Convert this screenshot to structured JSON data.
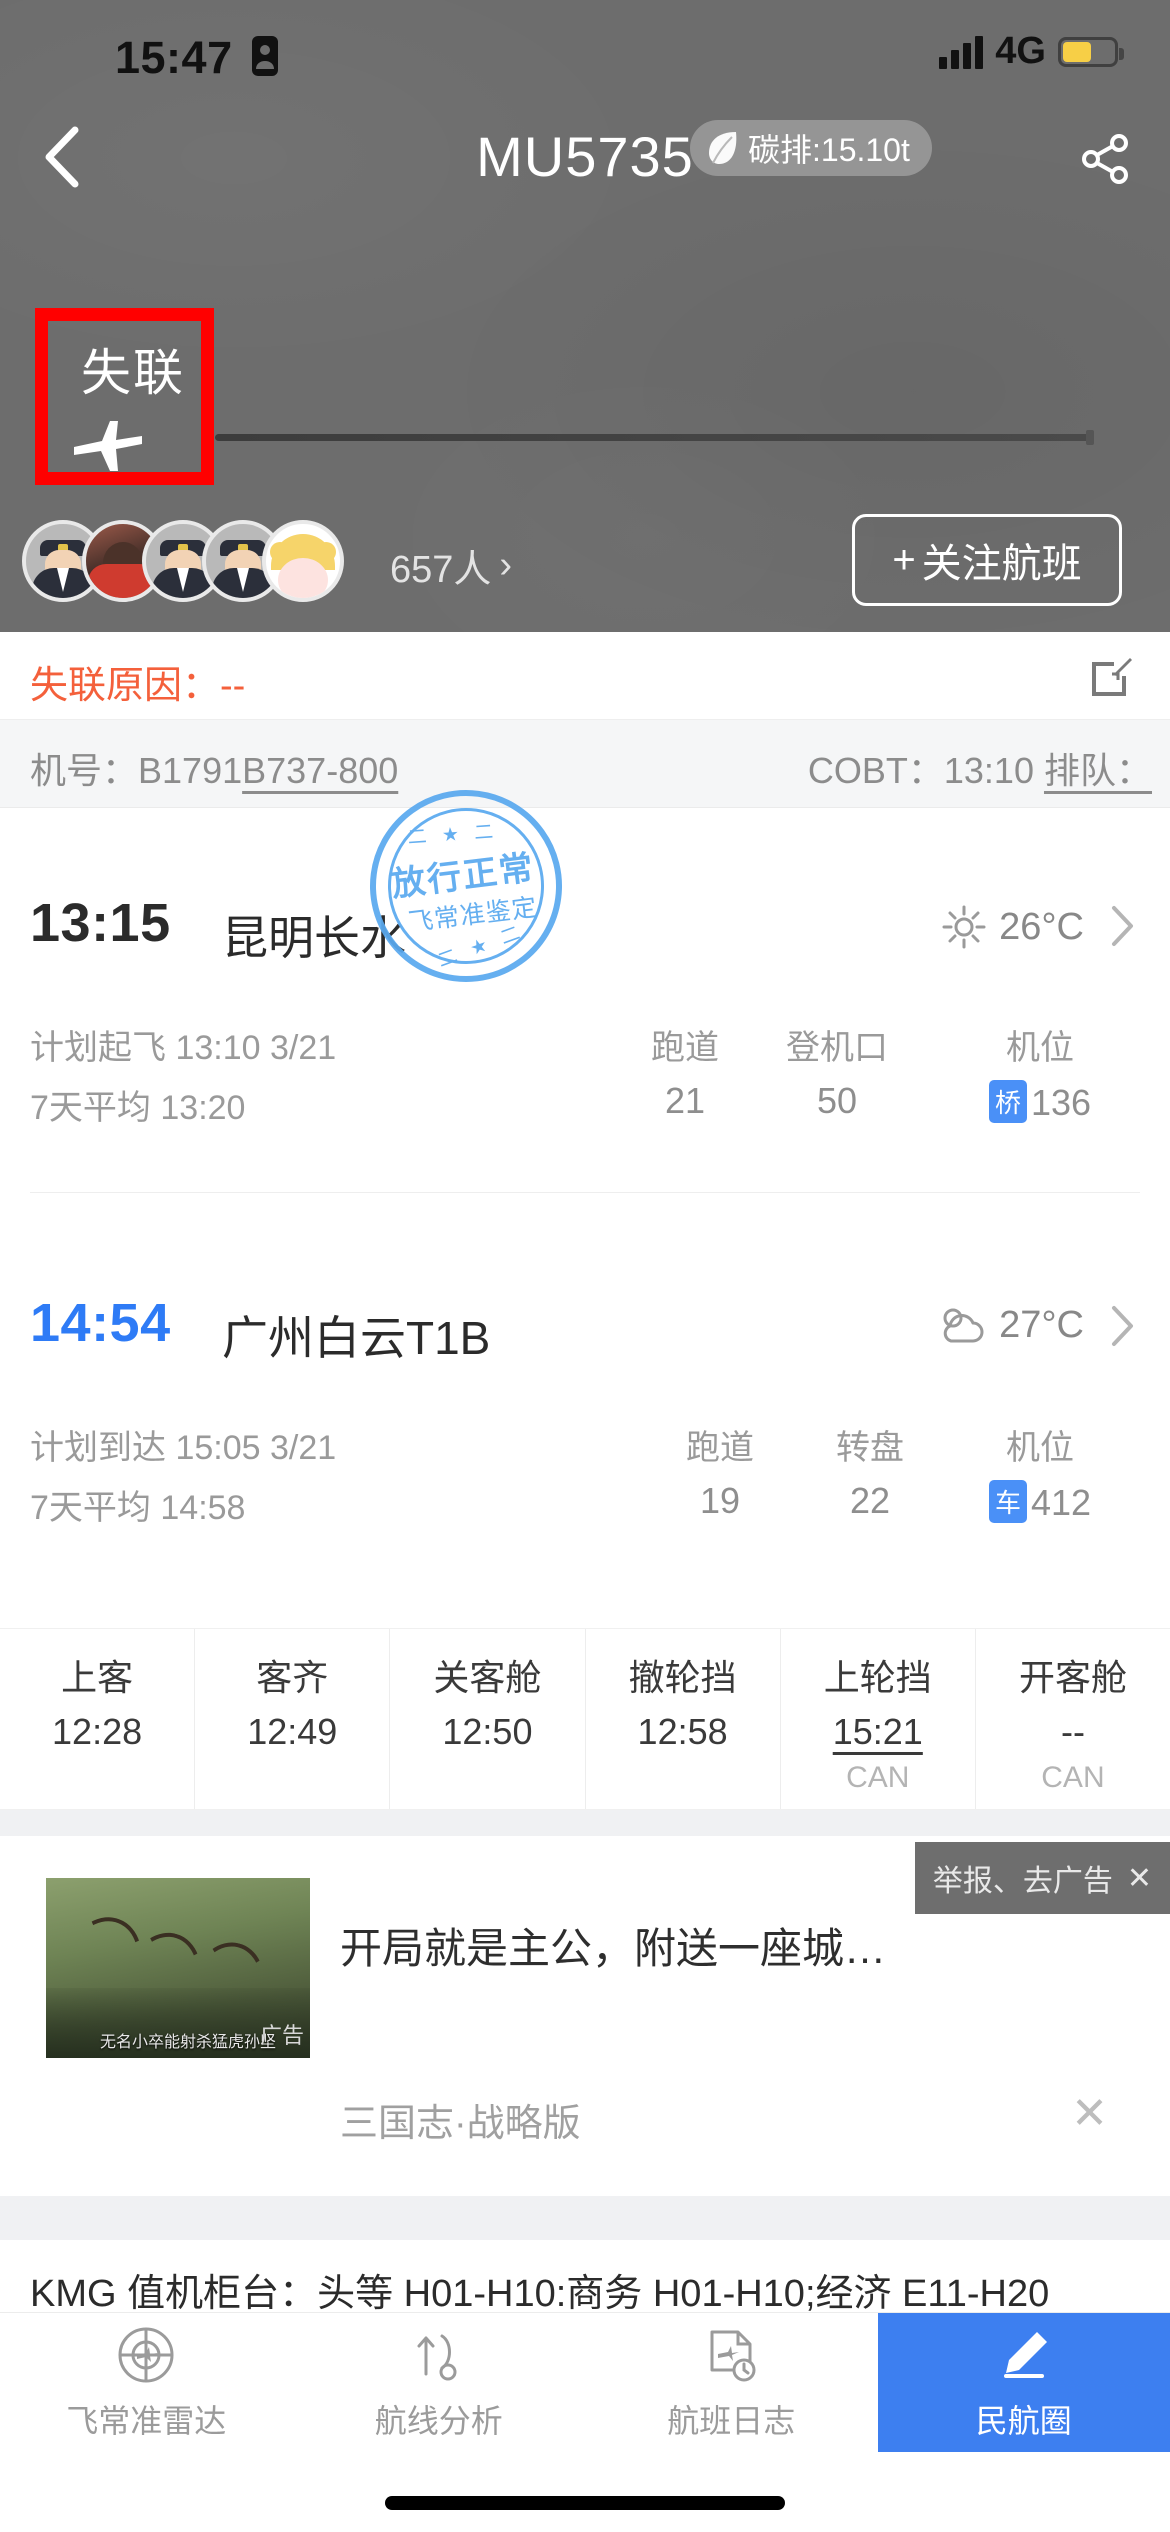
{
  "statusbar": {
    "time": "15:47",
    "network": "4G",
    "alarm_icon": "alarm-icon",
    "signal_icon": "signal-bars-icon",
    "battery_icon": "battery-icon"
  },
  "header": {
    "back_icon": "chevron-left-icon",
    "title": "MU5735",
    "carbon_label": "碳排:15.10t",
    "carbon_icon": "leaf-icon",
    "share_icon": "share-icon"
  },
  "hero": {
    "status_chip": "失联",
    "plane_icon": "airplane-icon",
    "follower_count": "657人",
    "follower_chevron": "›",
    "follow_button": "关注航班",
    "follow_plus": "+"
  },
  "reason": {
    "label": "失联原因：",
    "value": "--",
    "edit_icon": "edit-icon"
  },
  "registration": {
    "label": "机号：",
    "value": "B1791",
    "aircraft_type": "B737-800",
    "cobt_label": "COBT：",
    "cobt_value": "13:10",
    "queue_label": "排队："
  },
  "stamp": {
    "main": "放行正常",
    "sub": "飞常准鉴定",
    "band_top": "二 ★ 二",
    "band_bottom": "二 ★ 二"
  },
  "departure": {
    "time": "13:15",
    "airport": "昆明长水",
    "weather_icon": "sun-icon",
    "temperature": "26°C",
    "chevron": "›",
    "planned_label": "计划起飞",
    "planned_value": "13:10 3/21",
    "average_label": "7天平均",
    "average_value": "13:20",
    "columns": [
      {
        "header": "跑道",
        "value": "21"
      },
      {
        "header": "登机口",
        "value": "50"
      },
      {
        "header": "机位",
        "value": "136",
        "tag": "桥"
      }
    ]
  },
  "arrival": {
    "time": "14:54",
    "airport": "广州白云T1B",
    "weather_icon": "cloud-icon",
    "temperature": "27°C",
    "chevron": "›",
    "planned_label": "计划到达",
    "planned_value": "15:05 3/21",
    "average_label": "7天平均",
    "average_value": "14:58",
    "columns": [
      {
        "header": "跑道",
        "value": "19"
      },
      {
        "header": "转盘",
        "value": "22"
      },
      {
        "header": "机位",
        "value": "412",
        "tag": "车"
      }
    ]
  },
  "timeline": [
    {
      "name": "上客",
      "value": "12:28",
      "sub": ""
    },
    {
      "name": "客齐",
      "value": "12:49",
      "sub": ""
    },
    {
      "name": "关客舱",
      "value": "12:50",
      "sub": ""
    },
    {
      "name": "撤轮挡",
      "value": "12:58",
      "sub": ""
    },
    {
      "name": "上轮挡",
      "value": "15:21",
      "sub": "CAN"
    },
    {
      "name": "开客舱",
      "value": "--",
      "sub": "CAN"
    }
  ],
  "ad": {
    "report_text": "举报、去广告",
    "report_close": "✕",
    "title": "开局就是主公，附送一座城…",
    "brand": "三国志·战略版",
    "image_caption": "无名小卒能射杀猛虎孙坚",
    "image_badge": "广告",
    "close_icon": "✕"
  },
  "counter": {
    "text": "KMG 值机柜台：头等 H01-H10:商务 H01-H10;经济 E11-H20"
  },
  "tabbar": [
    {
      "label": "飞常准雷达",
      "icon": "radar-icon",
      "active": false
    },
    {
      "label": "航线分析",
      "icon": "route-icon",
      "active": false
    },
    {
      "label": "航班日志",
      "icon": "log-icon",
      "active": false
    },
    {
      "label": "民航圈",
      "icon": "pencil-icon",
      "active": true
    }
  ],
  "colors": {
    "accent": "#3d7ff0",
    "alert": "#f4603b",
    "highlight": "#ff0000",
    "stamp": "#5aa9ef"
  }
}
